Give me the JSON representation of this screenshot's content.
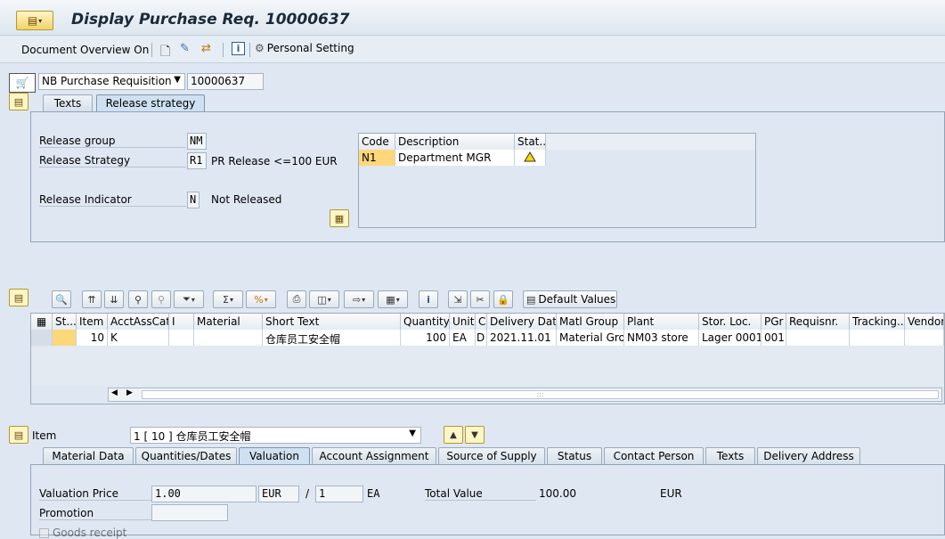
{
  "title": "Display Purchase Req. 10000637",
  "toolbar": {
    "document_overview": "Document Overview On",
    "personal_setting": "Personal Setting"
  },
  "header": {
    "doc_type": "NB Purchase Requisition",
    "doc_number": "10000637"
  },
  "header_tabs": [
    {
      "label": "Texts"
    },
    {
      "label": "Release strategy"
    }
  ],
  "release": {
    "group_label": "Release group",
    "group_value": "NM",
    "strategy_label": "Release Strategy",
    "strategy_value": "R1",
    "strategy_desc": "PR Release <=100 EUR",
    "indicator_label": "Release Indicator",
    "indicator_value": "N",
    "indicator_desc": "Not Released"
  },
  "release_table": {
    "headers": {
      "code": "Code",
      "description": "Description",
      "status": "Stat..."
    },
    "rows": [
      {
        "code": "N1",
        "description": "Department MGR"
      }
    ]
  },
  "items_toolbar": {
    "default_values": "Default Values"
  },
  "item_table": {
    "headers": {
      "st": "St...",
      "item": "Item",
      "acct": "AcctAssCat",
      "i": "I",
      "material": "Material",
      "short_text": "Short Text",
      "quantity": "Quantity",
      "unit": "Unit",
      "c": "C",
      "delivery_date": "Delivery Date",
      "matl_group": "Matl Group",
      "plant": "Plant",
      "stor_loc": "Stor. Loc.",
      "pgr": "PGr",
      "requisnr": "Requisnr.",
      "tracking": "Tracking...",
      "vendor": "Vendor"
    },
    "rows": [
      {
        "item": "10",
        "acct": "K",
        "short_text": "仓库员工安全帽",
        "quantity": "100",
        "unit": "EA",
        "c": "D",
        "delivery_date": "2021.11.01",
        "matl_group": "Material Gro...",
        "plant": "NM03 store",
        "stor_loc": "Lager 0001",
        "pgr": "001"
      }
    ]
  },
  "item_detail": {
    "item_label": "Item",
    "item_select": "1 [ 10 ] 仓库员工安全帽"
  },
  "item_tabs": [
    {
      "label": "Material Data"
    },
    {
      "label": "Quantities/Dates"
    },
    {
      "label": "Valuation"
    },
    {
      "label": "Account Assignment"
    },
    {
      "label": "Source of Supply"
    },
    {
      "label": "Status"
    },
    {
      "label": "Contact Person"
    },
    {
      "label": "Texts"
    },
    {
      "label": "Delivery Address"
    }
  ],
  "valuation": {
    "price_label": "Valuation Price",
    "price_value": "1.00",
    "currency": "EUR",
    "per_sep": "/",
    "per_value": "1",
    "per_unit": "EA",
    "total_label": "Total Value",
    "total_value": "100.00",
    "total_currency": "EUR",
    "promotion_label": "Promotion",
    "goods_receipt_label": "Goods receipt"
  }
}
